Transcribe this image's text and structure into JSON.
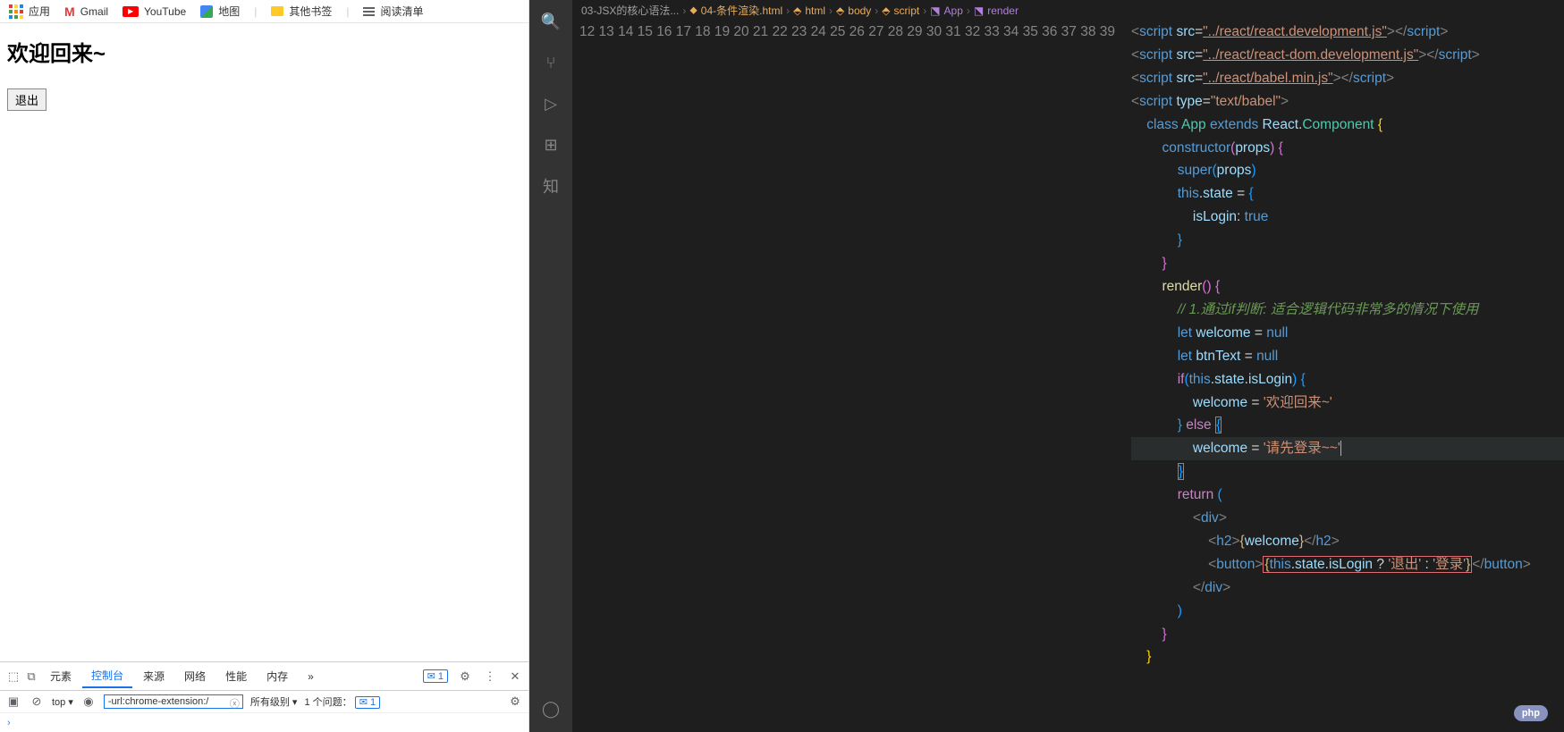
{
  "bookmarks": {
    "apps": "应用",
    "gmail": "Gmail",
    "youtube": "YouTube",
    "maps": "地图",
    "other": "其他书签",
    "reading": "阅读清单"
  },
  "page": {
    "heading": "欢迎回来~",
    "button": "退出"
  },
  "devtools": {
    "tabs": {
      "elements": "元素",
      "console": "控制台",
      "sources": "来源",
      "network": "网络",
      "performance": "性能",
      "memory": "内存"
    },
    "more": "»",
    "msg_count": "1",
    "context": "top ▾",
    "filter": "-url:chrome-extension:/",
    "levels": "所有级别 ▾",
    "issues_label": "1 个问题：",
    "issues_count": "1",
    "prompt": "›"
  },
  "vscode": {
    "breadcrumb": {
      "folder": "03-JSX的核心语法...",
      "file": "04-条件渲染.html",
      "path": [
        "html",
        "body",
        "script",
        "App",
        "render"
      ]
    },
    "line_start": 12,
    "line_end": 39,
    "code": {
      "l12": {
        "src": "../react/react.development.js"
      },
      "l13": {
        "src": "../react/react-dom.development.js"
      },
      "l14": {
        "src": "../react/babel.min.js"
      },
      "l15": {
        "type": "text/babel"
      },
      "comment24": "// 1.通过if判断: 适合逻辑代码非常多的情况下使用",
      "welcome_true": "'欢迎回来~'",
      "welcome_false": "'请先登录~~'",
      "btn_true": "'退出'",
      "btn_false": "'登录'"
    }
  },
  "php_badge": "php"
}
